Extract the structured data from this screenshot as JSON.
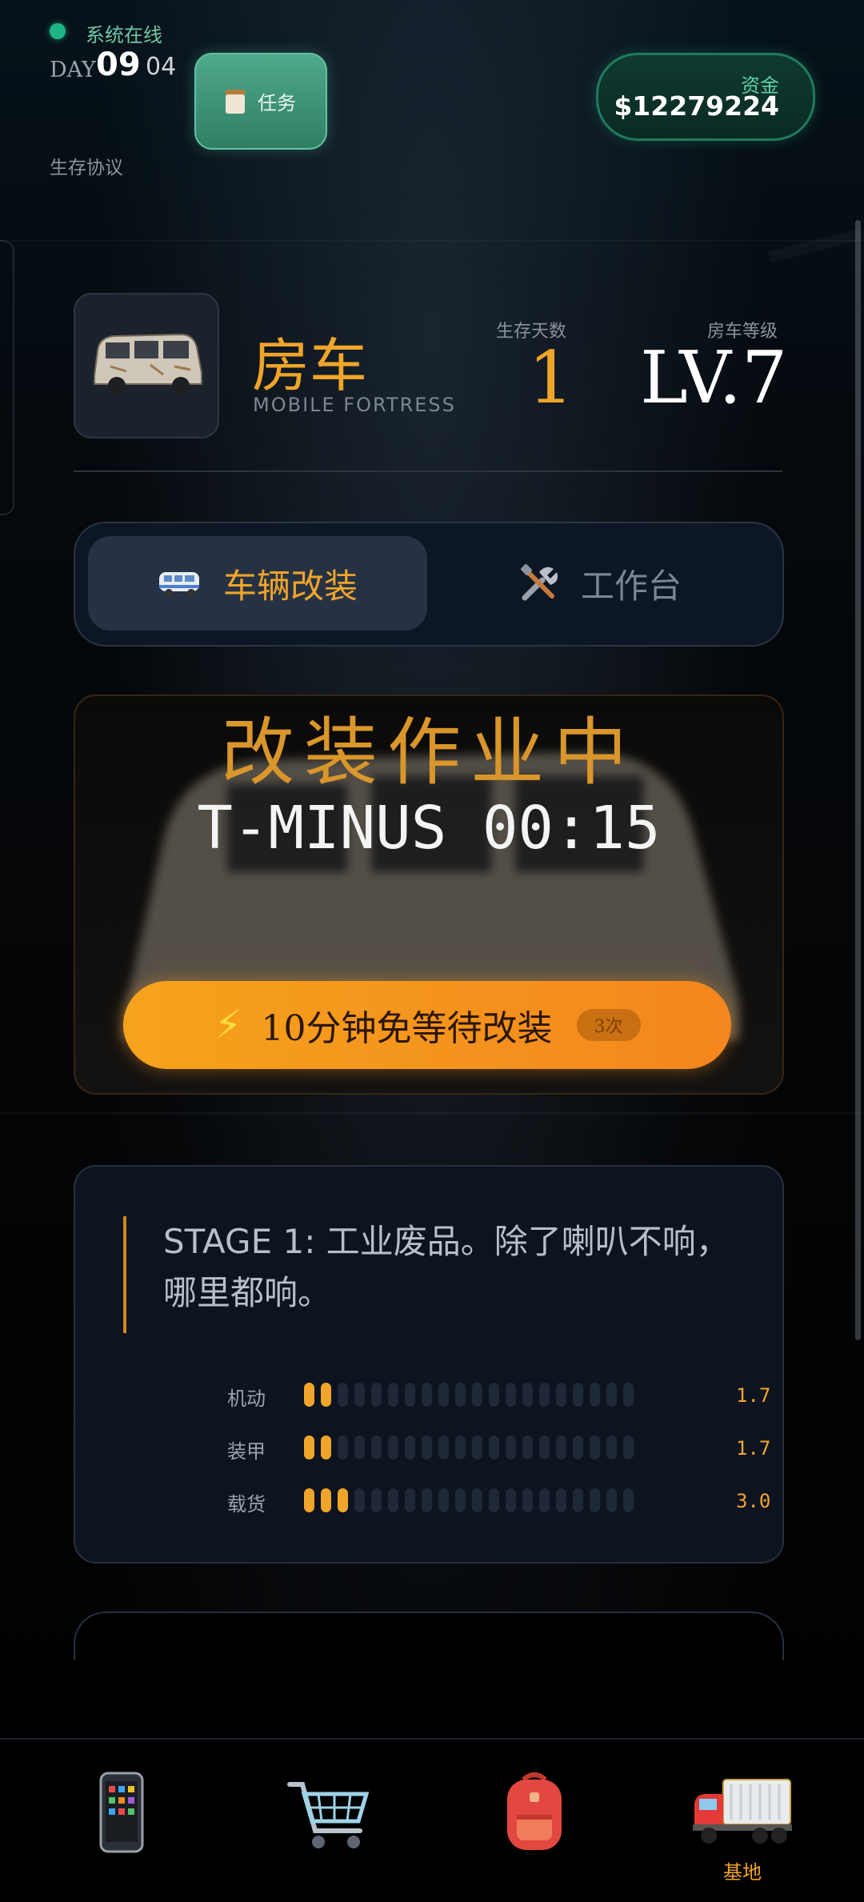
{
  "status": {
    "text": "系统在线",
    "color": "#1db584"
  },
  "day": {
    "label": "DAY",
    "number": "09",
    "sub": "04"
  },
  "protocol": "生存协议",
  "task_button": {
    "label": "任务",
    "icon": "clipboard-icon"
  },
  "funds": {
    "label": "资金",
    "value": "$12279224"
  },
  "vehicle": {
    "title": "房车",
    "subtitle": "MOBILE FORTRESS",
    "days_label": "生存天数",
    "days_value": "1",
    "level_label": "房车等级",
    "level_value": "LV.7"
  },
  "tabs": [
    {
      "label": "车辆改装",
      "icon": "minibus-icon",
      "active": true
    },
    {
      "label": "工作台",
      "icon": "tools-icon",
      "active": false
    }
  ],
  "modification": {
    "title": "改装作业中",
    "timer": "T-MINUS 00:15",
    "skip_button": {
      "label": "10分钟免等待改装",
      "badge": "3次",
      "icon": "lightning-icon"
    }
  },
  "stage": {
    "text": "STAGE 1: 工业废品。除了喇叭不响，哪里都响。",
    "meters": [
      {
        "label": "机动",
        "value": "1.7",
        "filled": 2,
        "total": 20
      },
      {
        "label": "装甲",
        "value": "1.7",
        "filled": 2,
        "total": 20
      },
      {
        "label": "载货",
        "value": "3.0",
        "filled": 3,
        "total": 20
      }
    ]
  },
  "nav": [
    {
      "icon": "phone-icon",
      "label": ""
    },
    {
      "icon": "shopping-cart-icon",
      "label": ""
    },
    {
      "icon": "backpack-icon",
      "label": ""
    },
    {
      "icon": "truck-icon",
      "label": "基地",
      "active": true
    }
  ],
  "colors": {
    "accent": "#f0a52a",
    "green": "#1db584",
    "panel": "#0e1320"
  }
}
